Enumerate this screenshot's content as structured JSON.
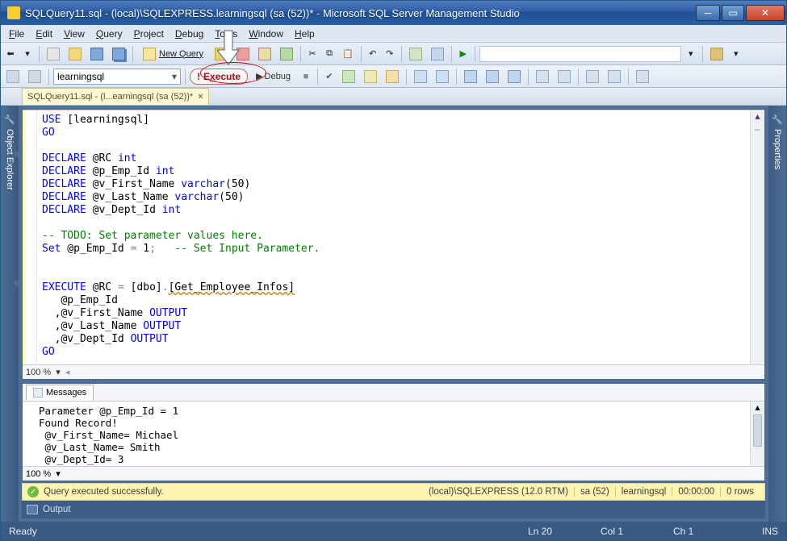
{
  "window": {
    "title": "SQLQuery11.sql - (local)\\SQLEXPRESS.learningsql (sa (52))* - Microsoft SQL Server Management Studio"
  },
  "menu": {
    "file": "File",
    "edit": "Edit",
    "view": "View",
    "query": "Query",
    "project": "Project",
    "debug": "Debug",
    "tools": "Tools",
    "window": "Window",
    "help": "Help"
  },
  "toolbar": {
    "newquery": "New Query",
    "database": "learningsql",
    "execute": "Execute",
    "debug": "Debug"
  },
  "tab": {
    "label": "SQLQuery11.sql - (l...earningsql (sa (52))*"
  },
  "sidebar_left": "Object Explorer",
  "sidebar_right": "Properties",
  "editor": {
    "zoom": "100 %",
    "code": {
      "l1a": "USE",
      "l1b": " [learningsql]",
      "l2": "GO",
      "l4a": "DECLARE",
      "l4b": " @RC ",
      "l4c": "int",
      "l5a": "DECLARE",
      "l5b": " @p_Emp_Id ",
      "l5c": "int",
      "l6a": "DECLARE",
      "l6b": " @v_First_Name ",
      "l6c": "varchar",
      "l6d": "(",
      "l6e": "50",
      "l6f": ")",
      "l7a": "DECLARE",
      "l7b": " @v_Last_Name ",
      "l7c": "varchar",
      "l7d": "(",
      "l7e": "50",
      "l7f": ")",
      "l8a": "DECLARE",
      "l8b": " @v_Dept_Id ",
      "l8c": "int",
      "l10": "-- TODO: Set parameter values here.",
      "l11a": "Set",
      "l11b": " @p_Emp_Id ",
      "l11c": "=",
      "l11d": " 1",
      "l11e": ";   ",
      "l11f": "-- Set Input Parameter.",
      "l14a": "EXECUTE",
      "l14b": " @RC ",
      "l14c": "=",
      "l14d": " [dbo]",
      "l14e": ".",
      "l14f": "[Get_Employee_Infos]",
      "l15": "   @p_Emp_Id",
      "l16a": "  ,@v_First_Name ",
      "l16b": "OUTPUT",
      "l17a": "  ,@v_Last_Name ",
      "l17b": "OUTPUT",
      "l18a": "  ,@v_Dept_Id ",
      "l18b": "OUTPUT",
      "l19": "GO"
    }
  },
  "messages": {
    "tab": "Messages",
    "zoom": "100 %",
    "l1": "Parameter @p_Emp_Id = 1",
    "l2": "Found Record!",
    "l3": " @v_First_Name= Michael",
    "l4": " @v_Last_Name= Smith",
    "l5": " @v_Dept_Id= 3"
  },
  "execbar": {
    "status": "Query executed successfully.",
    "server": "(local)\\SQLEXPRESS (12.0 RTM)",
    "user": "sa (52)",
    "db": "learningsql",
    "time": "00:00:00",
    "rows": "0 rows"
  },
  "outputbar": {
    "label": "Output"
  },
  "statusbar": {
    "ready": "Ready",
    "ln": "Ln 20",
    "col": "Col 1",
    "ch": "Ch 1",
    "ins": "INS"
  }
}
